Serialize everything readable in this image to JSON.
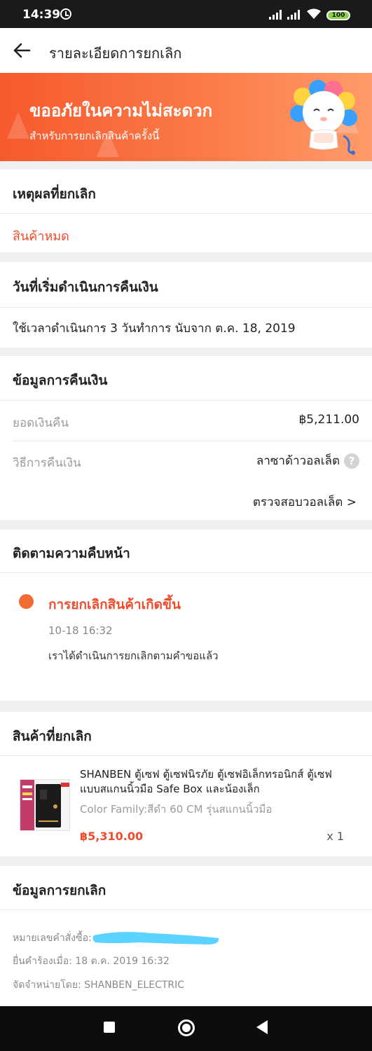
{
  "status_bar": {
    "time": "14:39",
    "battery": "100"
  },
  "header": {
    "title": "รายละเอียดการยกเลิก"
  },
  "banner": {
    "title": "ขออภัยในความไม่สะดวก",
    "subtitle": "สำหรับการยกเลิกสินค้าครั้งนี้"
  },
  "reason": {
    "title": "เหตุผลที่ยกเลิก",
    "value": "สินค้าหมด"
  },
  "refund_start": {
    "title": "วันที่เริ่มดำเนินการคืนเงิน",
    "value": "ใช้เวลาดำเนินการ 3 วันทำการ นับจาก ต.ค. 18, 2019"
  },
  "refund_info": {
    "title": "ข้อมูลการคืนเงิน",
    "amount_label": "ยอดเงินคืน",
    "amount_value": "฿5,211.00",
    "method_label": "วิธีการคืนเงิน",
    "method_value": "ลาซาด้าวอลเล็ต",
    "help_glyph": "?",
    "wallet_link": "ตรวจสอบวอลเล็ต >"
  },
  "tracking": {
    "title": "ติดตามความคืบหน้า",
    "event_title": "การยกเลิกสินค้าเกิดขึ้น",
    "event_time": "10-18   16:32",
    "event_desc": "เราได้ดำเนินการยกเลิกตามคำขอแล้ว"
  },
  "cancelled_items": {
    "title": "สินค้าที่ยกเลิก",
    "product": {
      "name": "SHANBEN ตู้เซฟ ตู้เซฟนิรภัย ตู้เซฟอิเล็กทรอนิกส์ ตู้เซฟแบบสแกนนิ้วมือ Safe Box และน้องเล็ก",
      "variant": "Color Family:สีดำ 60 CM รุ่นสแกนนิ้วมือ",
      "price": "฿5,310.00",
      "quantity": "x 1"
    }
  },
  "cancel_info": {
    "title": "ข้อมูลการยกเลิก",
    "order_number_label": "หมายเลขคำสั่งซื้อ:",
    "request_date": "ยื่นคำร้องเมื่อ: 18 ต.ค. 2019 16:32",
    "seller": "จัดจำหน่ายโดย: SHANBEN_ELECTRIC"
  },
  "colors": {
    "accent": "#ee4d2d",
    "banner": "#f65a2e"
  },
  "icons": [
    "alarm-icon",
    "signal-icon",
    "wifi-icon",
    "battery-icon",
    "back-arrow-icon",
    "mascot-icon",
    "help-icon",
    "status-dot-icon",
    "nav-square-icon",
    "nav-home-icon",
    "nav-back-icon"
  ]
}
